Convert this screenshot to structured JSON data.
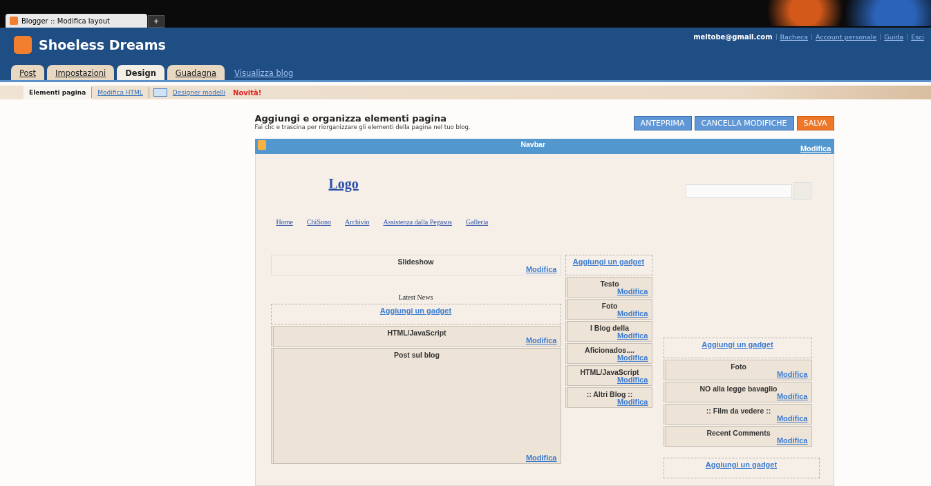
{
  "browser": {
    "tab_title": "Blogger :: Modifica layout",
    "new_tab": "+"
  },
  "header": {
    "blog_title": "Shoeless Dreams",
    "user_email": "meltobe@gmail.com",
    "links": [
      "Bacheca",
      "Account personale",
      "Guida",
      "Esci"
    ],
    "tabs": [
      {
        "label": "Post",
        "selected": false
      },
      {
        "label": "Impostazioni",
        "selected": false
      },
      {
        "label": "Design",
        "selected": true
      },
      {
        "label": "Guadagna",
        "selected": false
      }
    ],
    "view_blog": "Visualizza blog"
  },
  "subnav": {
    "items": [
      {
        "label": "Elementi pagina",
        "selected": true
      },
      {
        "label": "Modifica HTML",
        "selected": false
      },
      {
        "label": "Designer modelli",
        "selected": false
      }
    ],
    "badge": "Novità!"
  },
  "page": {
    "title": "Aggiungi e organizza elementi pagina",
    "subtitle": "Fai clic e trascina per riorganizzare gli elementi della pagina nel tuo blog.",
    "buttons": [
      {
        "label": "ANTEPRIMA",
        "kind": "secondary"
      },
      {
        "label": "CANCELLA MODIFICHE",
        "kind": "secondary"
      },
      {
        "label": "SALVA",
        "kind": "primary"
      }
    ]
  },
  "layout": {
    "navbar": {
      "title": "Navbar",
      "edit": "Modifica"
    },
    "logo": "Logo",
    "nav_links": [
      "Home",
      "ChiSono",
      "Archivio",
      "Assistenza dalla Pegasus",
      "Galleria"
    ],
    "main": [
      {
        "kind": "plain",
        "title": "Slideshow",
        "edit": "Modifica"
      },
      {
        "kind": "label",
        "title": "Latest News"
      },
      {
        "kind": "add",
        "title": "Aggiungi un gadget"
      },
      {
        "kind": "widget",
        "title": "HTML/JavaScript",
        "edit": "Modifica"
      },
      {
        "kind": "posts",
        "title": "Post sul blog",
        "edit": "Modifica"
      }
    ],
    "middle": [
      {
        "kind": "add",
        "title": "Aggiungi un gadget"
      },
      {
        "kind": "widget",
        "title": "Testo",
        "edit": "Modifica"
      },
      {
        "kind": "widget",
        "title": "Foto",
        "edit": "Modifica"
      },
      {
        "kind": "widget",
        "title": "I Blog della",
        "edit": "Modifica"
      },
      {
        "kind": "widget",
        "title": "Aficionados....",
        "edit": "Modifica"
      },
      {
        "kind": "widget",
        "title": "HTML/JavaScript",
        "edit": "Modifica"
      },
      {
        "kind": "widget",
        "title": ":: Altri Blog ::",
        "edit": "Modifica"
      }
    ],
    "right": [
      {
        "kind": "add",
        "title": "Aggiungi un gadget"
      },
      {
        "kind": "widget",
        "title": "Foto",
        "edit": "Modifica"
      },
      {
        "kind": "widget",
        "title": "NO alla legge bavaglio",
        "edit": "Modifica"
      },
      {
        "kind": "widget",
        "title": ":: Film da vedere ::",
        "edit": "Modifica"
      },
      {
        "kind": "widget",
        "title": "Recent Comments",
        "edit": "Modifica"
      },
      {
        "kind": "add",
        "title": "Aggiungi un gadget"
      }
    ]
  }
}
